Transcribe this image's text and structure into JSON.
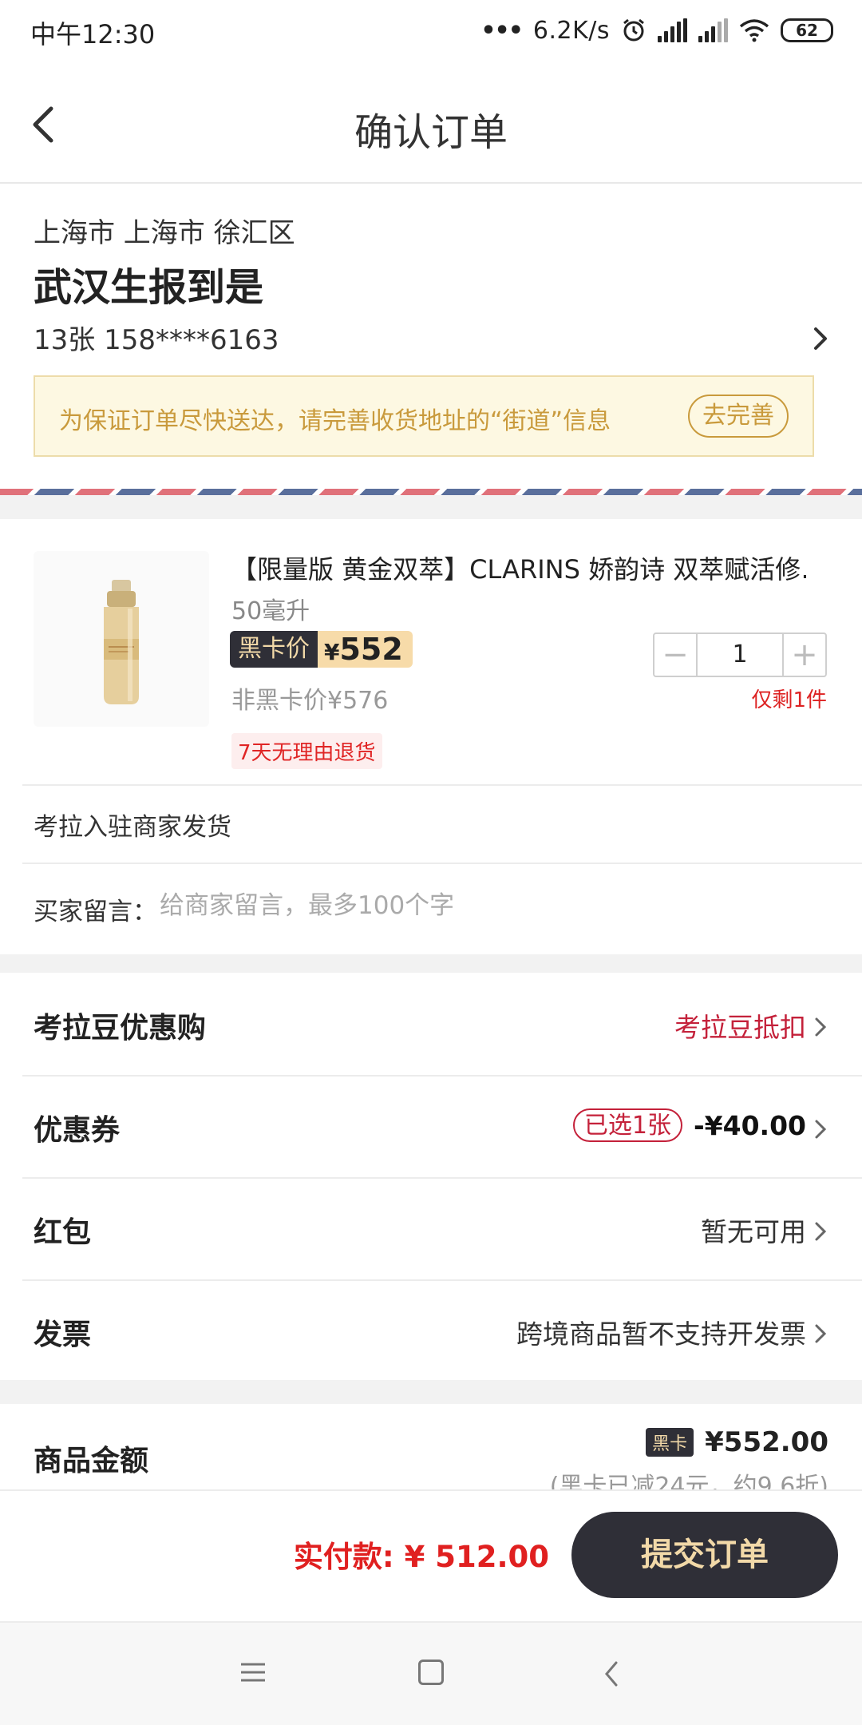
{
  "status_bar": {
    "time": "中午12:30",
    "dots": "•••",
    "net_speed": "6.2K/s",
    "battery": "62",
    "icons": [
      "alarm-icon",
      "signal-icon",
      "signal-icon",
      "wifi-icon",
      "battery-icon"
    ]
  },
  "nav": {
    "title": "确认订单"
  },
  "address": {
    "region": "上海市 上海市 徐汇区",
    "street": "武汉生报到是",
    "contact": "13张 158****6163",
    "notice": "为保证订单尽快送达，请完善收货地址的“街道”信息",
    "notice_button": "去完善"
  },
  "product": {
    "title": "【限量版 黄金双萃】CLARINS 娇韵诗 双萃赋活修…",
    "spec": "50毫升",
    "black_card_label": "黑卡价",
    "black_card_currency": "¥",
    "black_card_price": "552",
    "normal_price_label": "非黑卡价¥576",
    "refund_tag": "7天无理由退货",
    "quantity": "1",
    "minus": "−",
    "plus": "+",
    "stock": "仅剩1件",
    "seller": "考拉入驻商家发货",
    "message_label": "买家留言：",
    "message_placeholder": "给商家留言，最多100个字"
  },
  "options": {
    "beans": {
      "label": "考拉豆优惠购",
      "value": "考拉豆抵扣"
    },
    "coupon": {
      "label": "优惠券",
      "selected": "已选1张",
      "amount": "-¥40.00"
    },
    "red_packet": {
      "label": "红包",
      "value": "暂无可用"
    },
    "invoice": {
      "label": "发票",
      "value": "跨境商品暂不支持开发票"
    }
  },
  "summary": {
    "label": "商品金额",
    "card_badge": "黑卡",
    "amount": "¥552.00",
    "note": "(黑卡已减24元，约9.6折)"
  },
  "bottom_bar": {
    "pay_label": "实付款: ¥ 512.00",
    "submit": "提交订单"
  },
  "colors": {
    "accent_red": "#e02020",
    "brand_dark": "#2f2f37",
    "gold": "#f2d9a8",
    "notice_text": "#c99a3c"
  }
}
